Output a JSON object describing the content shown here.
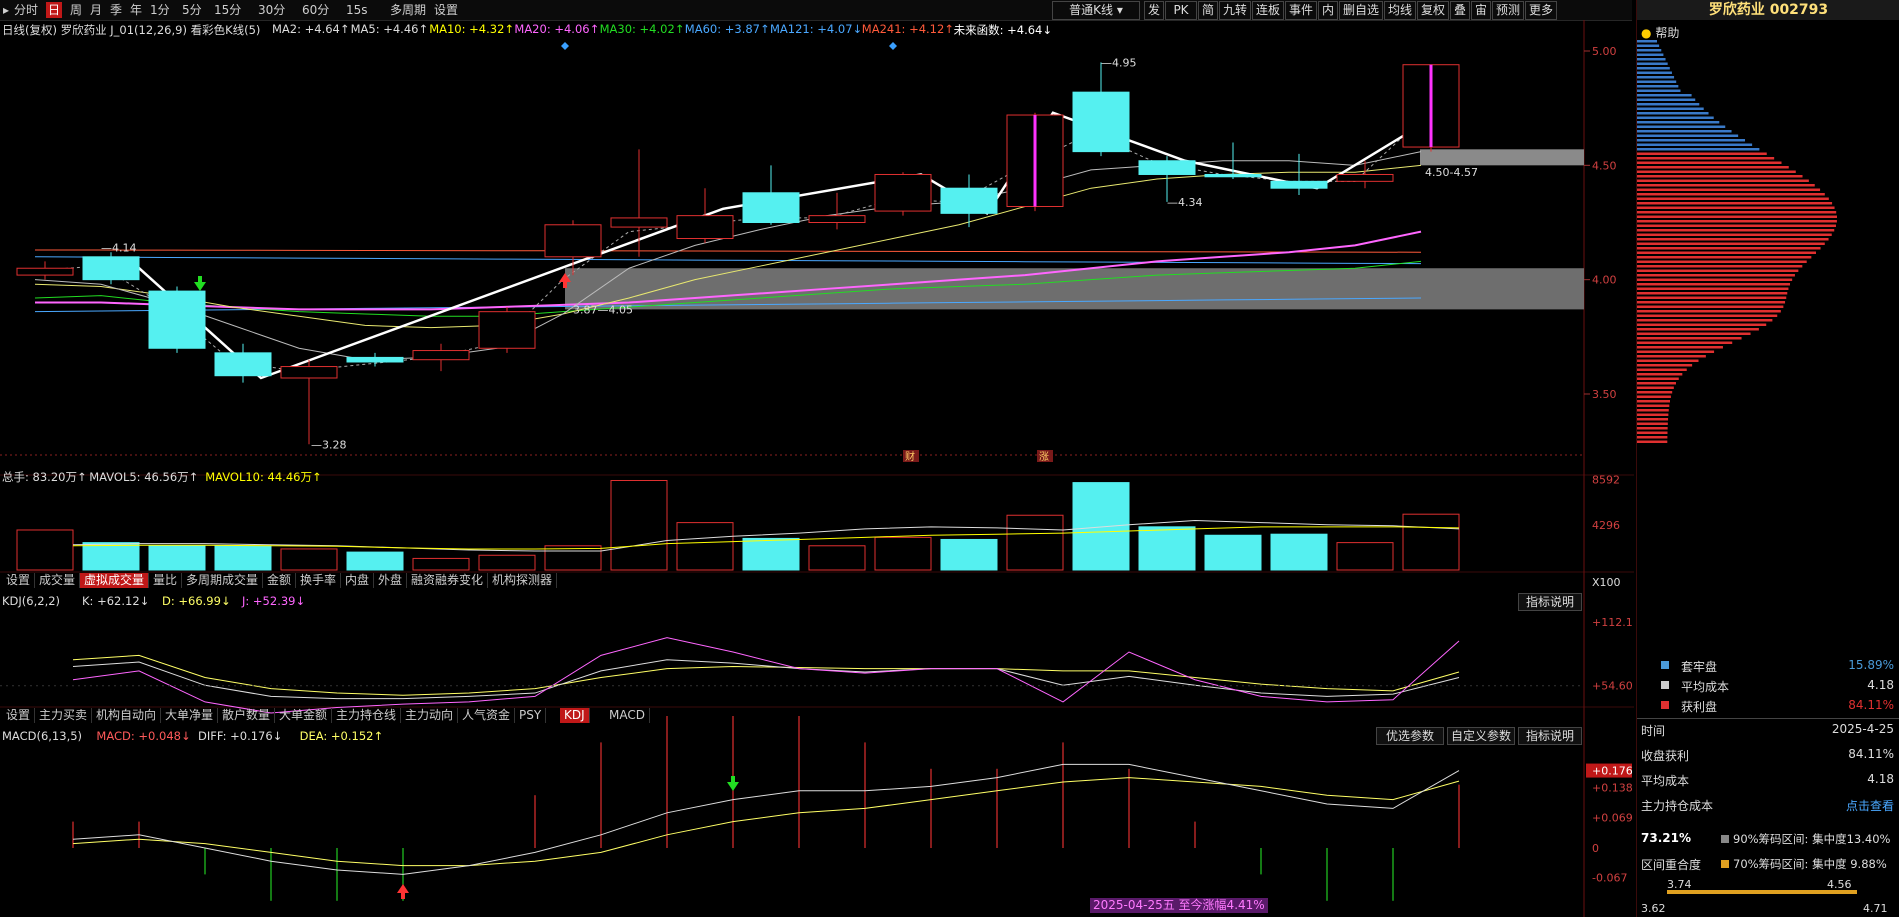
{
  "toolbar": {
    "items": [
      "分时",
      "日",
      "周",
      "月",
      "季",
      "年",
      "1分",
      "5分",
      "15分",
      "30分",
      "60分",
      "15s",
      "多周期",
      "设置"
    ],
    "active": "日",
    "kline_type": "普通K线",
    "right_items": [
      "发",
      "PK",
      "简",
      "九转",
      "连板",
      "事件",
      "内",
      "删自选",
      "均线",
      "复权",
      "叠",
      "宙",
      "预测",
      "更多"
    ]
  },
  "stock": {
    "name": "罗欣药业",
    "code": "002793",
    "title": "罗欣药业 002793"
  },
  "main_chart": {
    "header_prefix": "日线(复权)  罗欣药业  J_01(12,26,9)  看彩色K线(5)",
    "mas": [
      {
        "label": "MA2: +4.64↑",
        "color": "#dddddd"
      },
      {
        "label": "MA5: +4.46↑",
        "color": "#dddddd"
      },
      {
        "label": "MA10: +4.32↑",
        "color": "#ffff00"
      },
      {
        "label": "MA20: +4.06↑",
        "color": "#ff66ff"
      },
      {
        "label": "MA30: +4.02↑",
        "color": "#22dd22"
      },
      {
        "label": "MA60: +3.87↑",
        "color": "#4aa8ff"
      },
      {
        "label": "MA121: +4.07↓",
        "color": "#4aa8ff"
      },
      {
        "label": "MA241: +4.12↑",
        "color": "#ff5a3a"
      },
      {
        "label": "未来函数: +4.64↓",
        "color": "#ffffff"
      }
    ],
    "y_ticks": [
      "5.00",
      "4.50",
      "4.00",
      "3.50"
    ],
    "annotations": {
      "high": "4.95",
      "low": "3.28",
      "left_mark": "4.14",
      "mid_mark": "4.34",
      "left_low": "3.87",
      "left_low2": "4.05",
      "zone": "4.50-4.57"
    },
    "markers": [
      "财",
      "涨"
    ]
  },
  "candles": [
    {
      "o": 4.02,
      "c": 4.05,
      "h": 4.08,
      "l": 4.0
    },
    {
      "o": 4.1,
      "c": 4.0,
      "h": 4.12,
      "l": 3.98
    },
    {
      "o": 3.95,
      "c": 3.7,
      "h": 3.97,
      "l": 3.68
    },
    {
      "o": 3.68,
      "c": 3.58,
      "h": 3.72,
      "l": 3.55
    },
    {
      "o": 3.57,
      "c": 3.62,
      "h": 3.65,
      "l": 3.28
    },
    {
      "o": 3.66,
      "c": 3.64,
      "h": 3.68,
      "l": 3.62
    },
    {
      "o": 3.65,
      "c": 3.69,
      "h": 3.72,
      "l": 3.6
    },
    {
      "o": 3.7,
      "c": 3.86,
      "h": 3.88,
      "l": 3.68
    },
    {
      "o": 4.1,
      "c": 4.24,
      "h": 4.26,
      "l": 4.02
    },
    {
      "o": 4.23,
      "c": 4.27,
      "h": 4.57,
      "l": 4.1
    },
    {
      "o": 4.18,
      "c": 4.28,
      "h": 4.4,
      "l": 4.16
    },
    {
      "o": 4.38,
      "c": 4.25,
      "h": 4.5,
      "l": 4.24
    },
    {
      "o": 4.25,
      "c": 4.28,
      "h": 4.38,
      "l": 4.22
    },
    {
      "o": 4.3,
      "c": 4.46,
      "h": 4.47,
      "l": 4.28
    },
    {
      "o": 4.4,
      "c": 4.29,
      "h": 4.46,
      "l": 4.23
    },
    {
      "o": 4.32,
      "c": 4.72,
      "h": 4.73,
      "l": 4.3
    },
    {
      "o": 4.82,
      "c": 4.56,
      "h": 4.95,
      "l": 4.54
    },
    {
      "o": 4.52,
      "c": 4.46,
      "h": 4.54,
      "l": 4.34
    },
    {
      "o": 4.46,
      "c": 4.45,
      "h": 4.6,
      "l": 4.44
    },
    {
      "o": 4.43,
      "c": 4.4,
      "h": 4.55,
      "l": 4.37
    },
    {
      "o": 4.43,
      "c": 4.46,
      "h": 4.52,
      "l": 4.4
    },
    {
      "o": 4.58,
      "c": 4.94,
      "h": 4.94,
      "l": 4.56
    }
  ],
  "volume": {
    "header": [
      {
        "label": "总手: 83.20万↑",
        "color": "#dddddd"
      },
      {
        "label": "MAVOL5: 46.56万↑",
        "color": "#dddddd"
      },
      {
        "label": "MAVOL10: 44.46万↑",
        "color": "#ffff00"
      }
    ],
    "values": [
      3800,
      2600,
      2300,
      2300,
      2000,
      1700,
      1100,
      1400,
      2300,
      8500,
      4500,
      3000,
      2300,
      3100,
      2900,
      5200,
      8300,
      4100,
      3300,
      3400,
      2600,
      5300
    ],
    "ticks": [
      "8592",
      "4296",
      "X100"
    ]
  },
  "tabs1": [
    "设置",
    "成交量",
    "虚拟成交量",
    "量比",
    "多周期成交量",
    "金额",
    "换手率",
    "内盘",
    "外盘",
    "融资融券变化",
    "机构探测器"
  ],
  "tabs1_active": "虚拟成交量",
  "kdj": {
    "header": [
      {
        "label": "KDJ(6,2,2)",
        "color": "#dddddd"
      },
      {
        "label": "K: +62.12↓",
        "color": "#dddddd"
      },
      {
        "label": "D: +66.99↓",
        "color": "#ffff66"
      },
      {
        "label": "J: +52.39↓",
        "color": "#ff66ff"
      }
    ],
    "ticks": [
      "+112.1",
      "+54.60"
    ],
    "k": [
      72,
      76,
      55,
      45,
      43,
      43,
      45,
      48,
      68,
      78,
      75,
      70,
      67,
      70,
      70,
      55,
      63,
      55,
      48,
      45,
      47,
      62
    ],
    "d": [
      78,
      82,
      62,
      52,
      48,
      46,
      48,
      52,
      62,
      70,
      72,
      71,
      70,
      70,
      70,
      68,
      68,
      62,
      56,
      52,
      50,
      67
    ],
    "j": [
      60,
      68,
      40,
      30,
      35,
      38,
      40,
      45,
      82,
      98,
      85,
      70,
      66,
      70,
      70,
      40,
      85,
      60,
      45,
      40,
      42,
      95
    ],
    "button": "指标说明"
  },
  "tabs2": [
    "设置",
    "主力买卖",
    "机构自动向",
    "大单净量",
    "散户数量",
    "大单金额",
    "主力持仓线",
    "主力动向",
    "人气资金",
    "PSY",
    "KDJ",
    "MACD"
  ],
  "tabs2_active": "KDJ",
  "macd": {
    "header": [
      {
        "label": "MACD(6,13,5)",
        "color": "#dddddd"
      },
      {
        "label": "MACD: +0.048↓",
        "color": "#ff5a5a"
      },
      {
        "label": "DIFF: +0.176↓",
        "color": "#dddddd"
      },
      {
        "label": "DEA: +0.152↑",
        "color": "#ffff66"
      }
    ],
    "ticks": [
      "+0.176",
      "+0.138",
      "+0.069",
      "0",
      "-0.067"
    ],
    "diff": [
      0.02,
      0.03,
      0.0,
      -0.03,
      -0.05,
      -0.06,
      -0.04,
      -0.01,
      0.03,
      0.08,
      0.11,
      0.13,
      0.13,
      0.14,
      0.16,
      0.19,
      0.19,
      0.16,
      0.13,
      0.1,
      0.09,
      0.176
    ],
    "dea": [
      0.01,
      0.02,
      0.01,
      -0.01,
      -0.03,
      -0.04,
      -0.04,
      -0.03,
      -0.01,
      0.03,
      0.06,
      0.08,
      0.09,
      0.11,
      0.13,
      0.15,
      0.16,
      0.15,
      0.14,
      0.12,
      0.11,
      0.152
    ],
    "buttons": [
      "优选参数",
      "自定义参数",
      "指标说明"
    ],
    "footer_date": "2025-04-25五 至今涨幅4.41%"
  },
  "right_panel": {
    "help": "帮助",
    "legend": [
      {
        "label": "套牢盘",
        "value": "15.89%",
        "color": "#4a9ad8"
      },
      {
        "label": "平均成本",
        "value": "4.18",
        "color": "#cccccc"
      },
      {
        "label": "获利盘",
        "value": "84.11%",
        "color": "#e03030"
      }
    ],
    "rows": [
      {
        "label": "时间",
        "value": "2025-4-25"
      },
      {
        "label": "收盘获利",
        "value": "84.11%"
      },
      {
        "label": "平均成本",
        "value": "4.18"
      },
      {
        "label": "主力持仓成本",
        "value": "点击查看"
      }
    ],
    "pct": "73.21%",
    "range_label": "区间重合度",
    "c90": "90%筹码区间: 集中度13.40%",
    "c70": "70%筹码区间: 集中度 9.88%",
    "axis": [
      "3.62",
      "3.74",
      "4.56",
      "4.71"
    ]
  }
}
